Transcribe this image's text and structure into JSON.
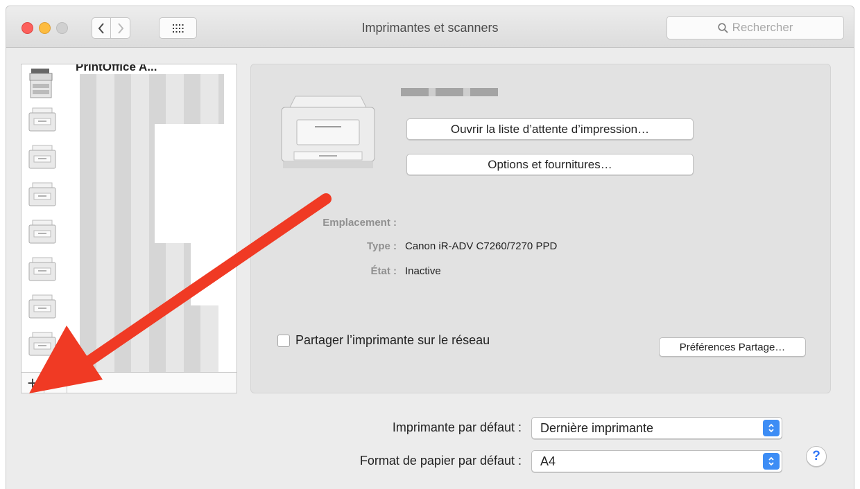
{
  "window": {
    "title": "Imprimantes et scanners",
    "search_placeholder": "Rechercher"
  },
  "printers": [
    {
      "label": "PrintOffice A..."
    },
    {
      "label": ""
    },
    {
      "label": ""
    },
    {
      "label": ""
    },
    {
      "label": ""
    },
    {
      "label": ""
    },
    {
      "label": ""
    },
    {
      "label": ""
    }
  ],
  "list_footer": {
    "add": "+",
    "remove": "−"
  },
  "detail": {
    "open_queue_button": "Ouvrir la liste d’attente d’impression…",
    "options_button": "Options et fournitures…",
    "location_label": "Emplacement :",
    "type_label": "Type :",
    "type_value": "Canon iR-ADV C7260/7270 PPD",
    "state_label": "État :",
    "state_value": "Inactive",
    "share_label": "Partager l’imprimante sur le réseau",
    "share_prefs_button": "Préférences Partage…"
  },
  "defaults": {
    "printer_label": "Imprimante par défaut :",
    "printer_value": "Dernière imprimante",
    "paper_label": "Format de papier par défaut :",
    "paper_value": "A4"
  },
  "help": "?",
  "colors": {
    "annotation_arrow": "#f03a24",
    "accent": "#3d8df5"
  }
}
